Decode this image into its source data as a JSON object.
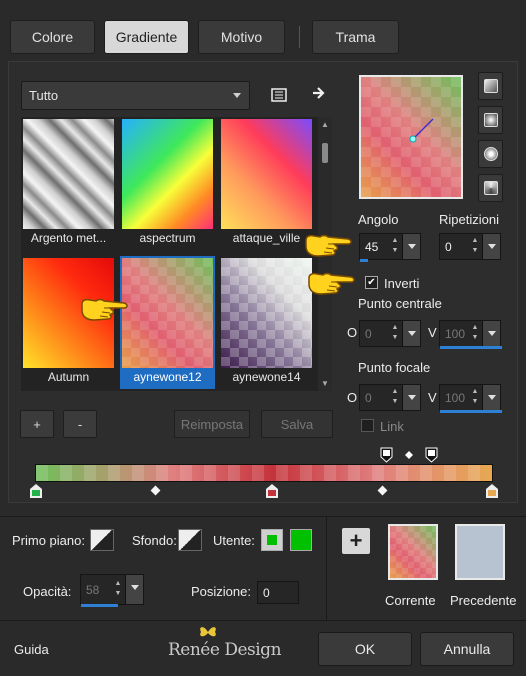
{
  "tabs": [
    {
      "label": "Colore",
      "active": false
    },
    {
      "label": "Gradiente",
      "active": true
    },
    {
      "label": "Motivo",
      "active": false
    },
    {
      "label": "Trama",
      "active": false
    }
  ],
  "category_dropdown": {
    "value": "Tutto"
  },
  "gallery": {
    "items": [
      {
        "caption": "Argento met..."
      },
      {
        "caption": "aspectrum"
      },
      {
        "caption": "attaque_ville"
      },
      {
        "caption": "Autumn"
      },
      {
        "caption": "aynewone12",
        "selected": true
      },
      {
        "caption": "aynewone14"
      }
    ]
  },
  "gallery_buttons": {
    "add": "+",
    "remove": "-",
    "reset": "Reimposta",
    "save": "Salva"
  },
  "angle": {
    "label": "Angolo",
    "value": "45",
    "progress": 0.13
  },
  "repeats": {
    "label": "Ripetizioni",
    "value": "0"
  },
  "invert": {
    "label": "Inverti",
    "checked": true
  },
  "center_point": {
    "label": "Punto centrale",
    "o_label": "O",
    "o_value": "0",
    "v_label": "V",
    "v_value": "100"
  },
  "focal_point": {
    "label": "Punto focale",
    "o_label": "O",
    "o_value": "0",
    "v_label": "V",
    "v_value": "100"
  },
  "link": {
    "label": "Link",
    "checked": false
  },
  "bottom": {
    "foreground_label": "Primo piano:",
    "background_label": "Sfondo:",
    "user_label": "Utente:",
    "user_color": "#00c000",
    "opacity_label": "Opacità:",
    "opacity_value": "58",
    "opacity_progress": 0.58,
    "position_label": "Posizione:",
    "position_value": "0",
    "current_label": "Corrente",
    "previous_label": "Precedente",
    "previous_color": "#b7c3d1"
  },
  "footer": {
    "guide_label": "Guida",
    "ok_label": "OK",
    "cancel_label": "Annulla",
    "logo_text": "Renée Design"
  },
  "colors": {
    "accent": "#1f6dc2",
    "panel": "#2a2a2a",
    "green_stop": "#21b24a",
    "red_stop": "#c4333b",
    "orange_stop": "#e7a852"
  }
}
